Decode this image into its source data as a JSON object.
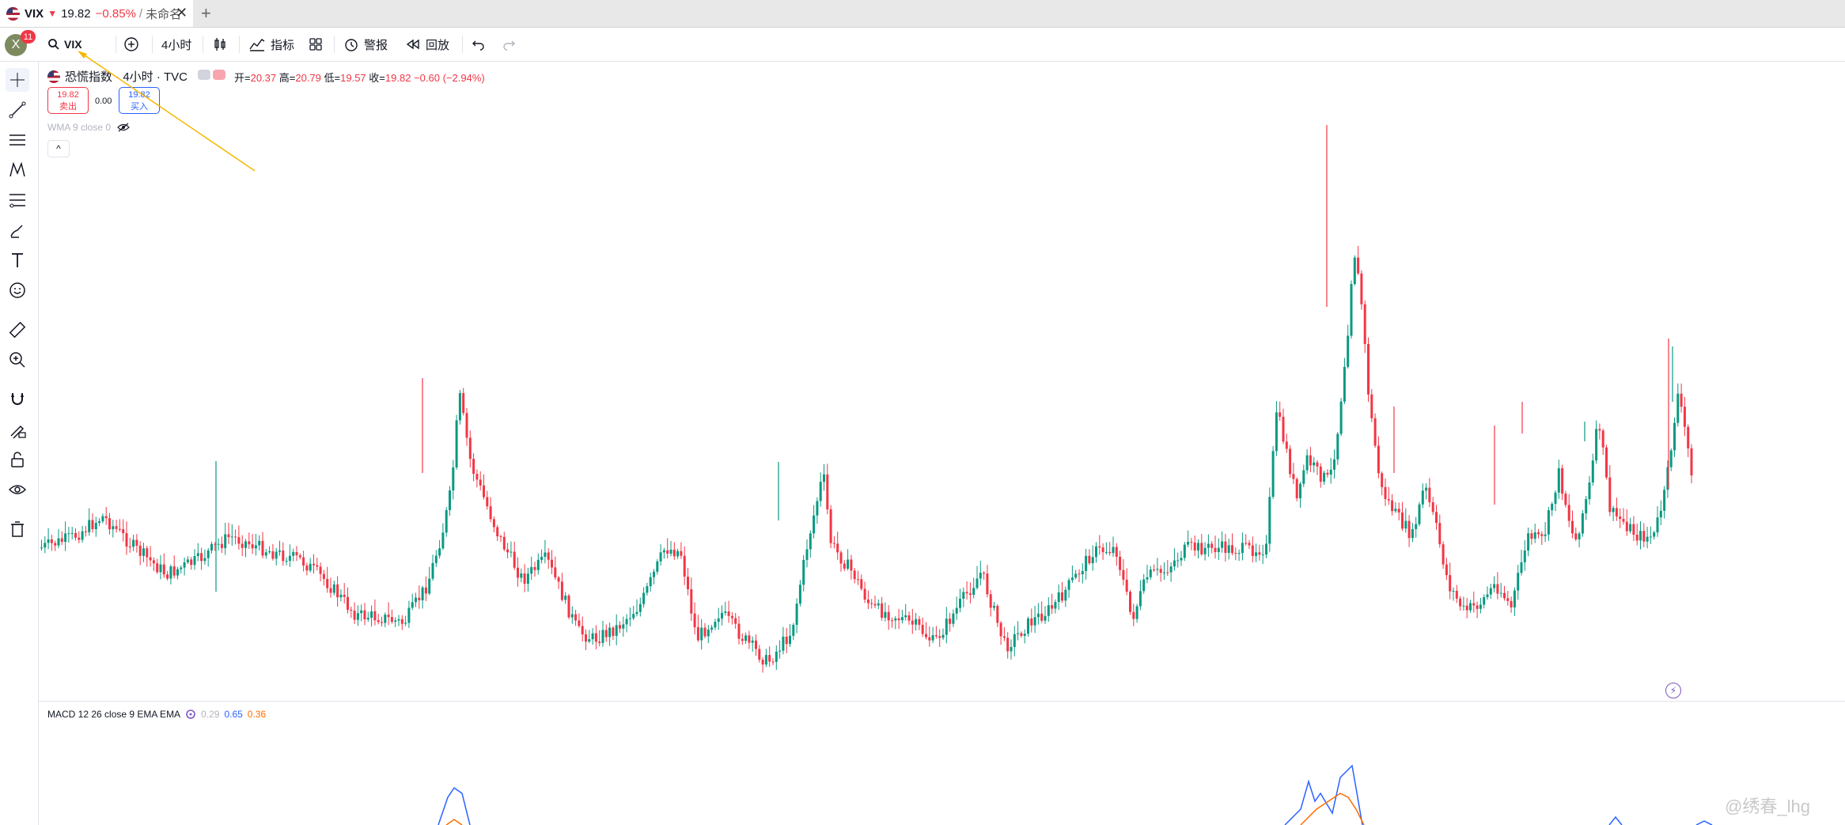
{
  "tab": {
    "symbol": "VIX",
    "arrow": "▼",
    "price": "19.82",
    "change": "−0.85%",
    "separator": "/",
    "layout_name": "未命名",
    "close": "✕",
    "new_tab": "+"
  },
  "toolbar": {
    "avatar_letter": "X",
    "notifications": "11",
    "symbol_search": "VIX",
    "interval": "4小时",
    "indicators": "指标",
    "alerts": "警报",
    "replay": "回放"
  },
  "left_tools": [
    "cross-icon",
    "trend-line-icon",
    "horizontal-lines-icon",
    "pattern-icon",
    "fib-icon",
    "brush-icon",
    "text-icon",
    "emoji-icon",
    "ruler-icon",
    "zoom-in-icon",
    "magnet-icon",
    "lock-pencil-icon",
    "lock-icon",
    "eye-icon",
    "trash-icon"
  ],
  "legend": {
    "title": "恐慌指数 · 4小时 · TVC",
    "open_label": "开=",
    "open": "20.37",
    "high_label": "高=",
    "high": "20.79",
    "low_label": "低=",
    "low": "19.57",
    "close_label": "收=",
    "close": "19.82",
    "change": "−0.60 (−2.94%)",
    "sell_price": "19.82",
    "sell_label": "卖出",
    "spread": "0.00",
    "buy_price": "19.82",
    "buy_label": "买入",
    "wma": "WMA 9 close 0",
    "collapse": "^"
  },
  "macd": {
    "label": "MACD 12 26 close 9 EMA EMA",
    "hist": "0.29",
    "macd": "0.65",
    "signal": "0.36"
  },
  "watermark": "@绣春_lhg",
  "colors": {
    "up": "#089981",
    "down": "#f23645",
    "macd": "#2962ff",
    "signal": "#ff6d00",
    "annotation": "#f5b800"
  }
}
